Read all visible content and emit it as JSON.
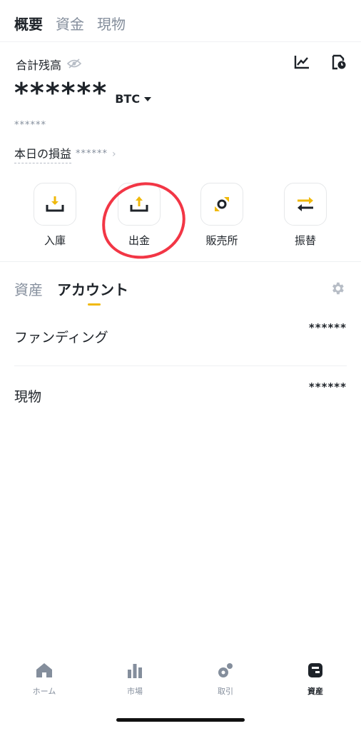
{
  "top_tabs": {
    "overview": "概要",
    "funds": "資金",
    "spot": "現物"
  },
  "summary": {
    "total_label": "合計残高",
    "balance_masked": "******",
    "unit": "BTC",
    "sub_masked": "******",
    "pnl_label": "本日の損益",
    "pnl_masked": "******"
  },
  "actions": [
    {
      "label": "入庫",
      "icon": "deposit-icon"
    },
    {
      "label": "出金",
      "icon": "withdraw-icon"
    },
    {
      "label": "販売所",
      "icon": "convert-icon"
    },
    {
      "label": "振替",
      "icon": "transfer-icon"
    }
  ],
  "section_tabs": {
    "assets": "資産",
    "account": "アカウント"
  },
  "accounts": [
    {
      "name": "ファンディング",
      "amount": "******"
    },
    {
      "name": "現物",
      "amount": "******"
    }
  ],
  "bottom_nav": [
    {
      "label": "ホーム",
      "icon": "home-icon"
    },
    {
      "label": "市場",
      "icon": "market-icon"
    },
    {
      "label": "取引",
      "icon": "trade-icon"
    },
    {
      "label": "資産",
      "icon": "wallet-icon"
    }
  ],
  "colors": {
    "accent": "#f0b90b",
    "text": "#1e2329",
    "muted": "#848e9c",
    "annotation": "#f23645"
  }
}
